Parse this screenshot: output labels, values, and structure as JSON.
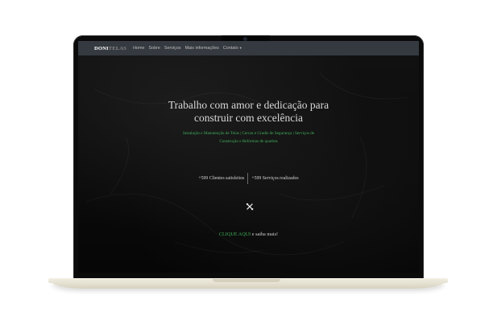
{
  "navbar": {
    "brand_part1": "DONI",
    "brand_part2": "TELAS",
    "items": [
      {
        "label": "Home"
      },
      {
        "label": "Sobre"
      },
      {
        "label": "Serviços"
      },
      {
        "label": "Mais informações"
      },
      {
        "label": "Contato"
      }
    ]
  },
  "hero": {
    "title_line1": "Trabalho com amor e dedicação para",
    "title_line2": "construir com excelência",
    "sub_line1": "Instalação e Manutenção de Telas | Cercas e Gradis de Segurança | Serviços de",
    "sub_line2": "Construção e Reformas de quadras"
  },
  "stats": {
    "clients": "+599 Clientes satisfeitos",
    "services": "+599 Serviços realizados"
  },
  "cta": {
    "link": "CLIQUE AQUI",
    "rest": " e saiba mais!"
  },
  "colors": {
    "navbar_bg": "#343a40",
    "accent_green": "#3fae5a",
    "screen_bg": "#0a0a0a"
  },
  "icons": {
    "center": "tools-icon",
    "contact_caret": "chevron-down-icon"
  }
}
